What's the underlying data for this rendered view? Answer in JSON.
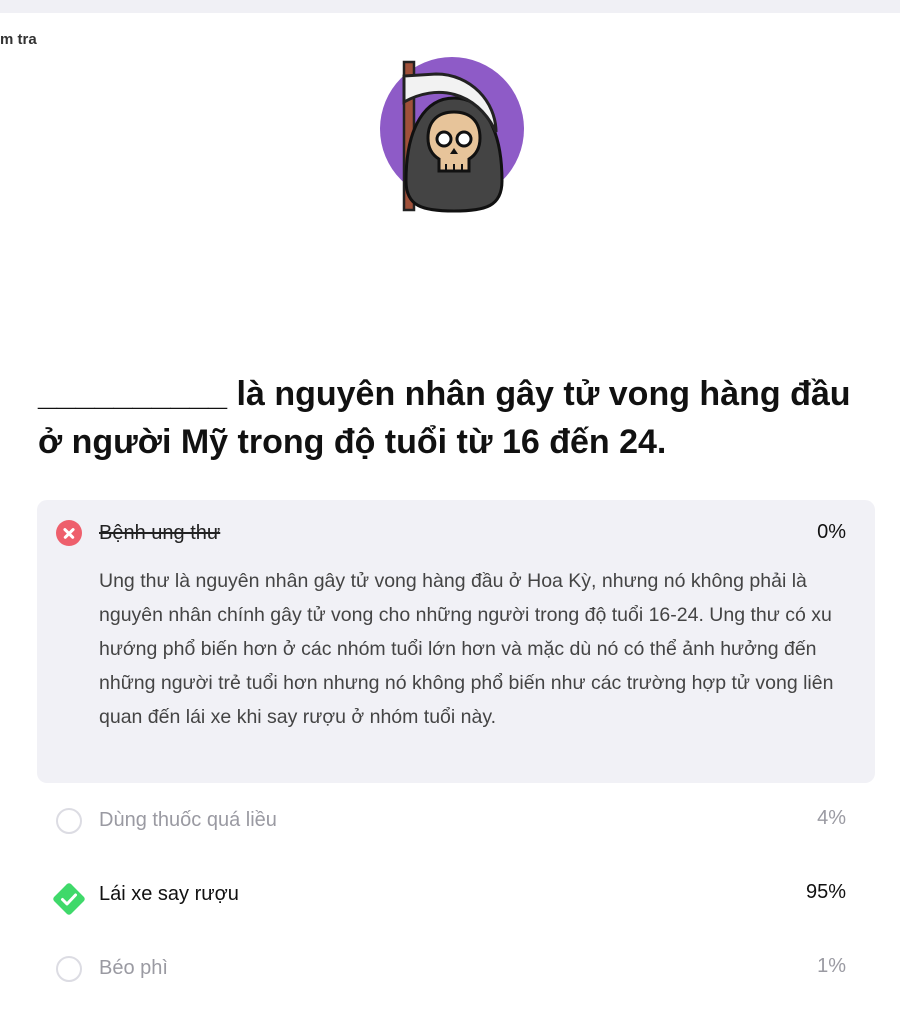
{
  "breadcrumb": "m tra",
  "illustration_icon": "grim-reaper-icon",
  "question": "__________ là nguyên nhân gây tử vong hàng đầu ở người Mỹ trong độ tuổi từ 16 đến 24.",
  "colors": {
    "wrong": "#ee5f6c",
    "correct": "#3fd96a",
    "expanded_bg": "#f1f1f6",
    "avatar_bg": "#8e5bc7"
  },
  "answers": [
    {
      "label": "Bệnh ung thư",
      "percent": "0%",
      "status": "wrong",
      "explanation": "Ung thư là nguyên nhân gây tử vong hàng đầu ở Hoa Kỳ, nhưng nó không phải là nguyên nhân chính gây tử vong cho những người trong độ tuổi 16-24. Ung thư có xu hướng phổ biến hơn ở các nhóm tuổi lớn hơn và mặc dù nó có thể ảnh hưởng đến những người trẻ tuổi hơn nhưng nó không phổ biến như các trường hợp tử vong liên quan đến lái xe khi say rượu ở nhóm tuổi này."
    },
    {
      "label": "Dùng thuốc quá liều",
      "percent": "4%",
      "status": "unselected"
    },
    {
      "label": "Lái xe say rượu",
      "percent": "95%",
      "status": "correct"
    },
    {
      "label": "Béo phì",
      "percent": "1%",
      "status": "unselected"
    }
  ]
}
